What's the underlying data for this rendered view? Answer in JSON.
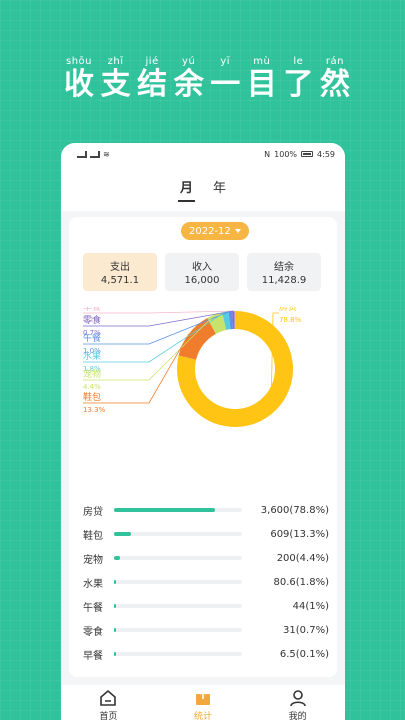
{
  "headline": {
    "pinyin": [
      "shōu",
      "zhī",
      "jié",
      "yú",
      "yī",
      "mù",
      "le",
      "rán"
    ],
    "hanzi": [
      "收",
      "支",
      "结",
      "余",
      "一",
      "目",
      "了",
      "然"
    ]
  },
  "status": {
    "left": "⁴ᴳ ⁴ᴳ",
    "battery": "100%",
    "time": "4:59",
    "nfc": "N"
  },
  "tabs": [
    {
      "label": "月"
    },
    {
      "label": "年"
    }
  ],
  "date": "2022-12",
  "summary": [
    {
      "label": "支出",
      "value": "4,571.1"
    },
    {
      "label": "收入",
      "value": "16,000"
    },
    {
      "label": "结余",
      "value": "11,428.9"
    }
  ],
  "colors": {
    "accent": "#2fc29b",
    "orange": "#f7b543",
    "slices": [
      "#ffc414",
      "#f07d2b",
      "#c8e36b",
      "#57cce0",
      "#5a91e5",
      "#7a6fce",
      "#f5b7c7"
    ]
  },
  "chart_data": {
    "type": "pie",
    "categories": [
      "房贷",
      "鞋包",
      "宠物",
      "水果",
      "午餐",
      "零食",
      "早餐"
    ],
    "values": [
      3600,
      609,
      200,
      80.6,
      44,
      31,
      6.5
    ],
    "percents": [
      "78.8%",
      "13.3%",
      "4.4%",
      "1.8%",
      "1%",
      "0.7%",
      "0.1%"
    ],
    "chart_percent_labels": [
      "78.8%",
      "13.3%",
      "4.4%",
      "1.8%",
      "1.0%",
      "0.7%",
      "0.1%"
    ]
  },
  "list": [
    {
      "name": "房贷",
      "amount": "3,600",
      "pct": "(78.8%)",
      "ratio": 0.788
    },
    {
      "name": "鞋包",
      "amount": "609",
      "pct": "(13.3%)",
      "ratio": 0.133
    },
    {
      "name": "宠物",
      "amount": "200",
      "pct": "(4.4%)",
      "ratio": 0.044
    },
    {
      "name": "水果",
      "amount": "80.6",
      "pct": "(1.8%)",
      "ratio": 0.018
    },
    {
      "name": "午餐",
      "amount": "44",
      "pct": "(1%)",
      "ratio": 0.01
    },
    {
      "name": "零食",
      "amount": "31",
      "pct": "(0.7%)",
      "ratio": 0.007
    },
    {
      "name": "早餐",
      "amount": "6.5",
      "pct": "(0.1%)",
      "ratio": 0.001
    }
  ],
  "nav": [
    {
      "label": "首页",
      "icon": "home-icon"
    },
    {
      "label": "统计",
      "icon": "stats-icon"
    },
    {
      "label": "我的",
      "icon": "user-icon"
    }
  ]
}
